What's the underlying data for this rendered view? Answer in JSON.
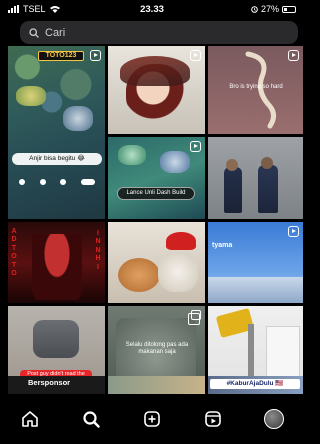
{
  "status_bar": {
    "carrier": "TSEL",
    "time": "23.33",
    "battery": "27%"
  },
  "search": {
    "placeholder": "Cari"
  },
  "tiles": {
    "t1": {
      "logo": "TOTO123",
      "caption": "Anjir bisa begitu 😂"
    },
    "t3": {
      "caption": "Bro is trying so hard"
    },
    "t5": {
      "caption": "Lance Unli Dash Build"
    },
    "t7": {
      "side_text": "A D T O T O",
      "side_text_right": "I N N H I"
    },
    "t9": {
      "watermark": "tyama"
    },
    "t10": {
      "caption": "Post guy didn't read the warning label 😂"
    },
    "t11": {
      "caption": "Selalu ditolong pas ada makanan saja"
    },
    "t13": {
      "caption": "Bersponsor"
    },
    "t15": {
      "caption": "#KaburAjaDulu 🇺🇸"
    }
  },
  "nav": {
    "items": [
      {
        "icon": "home-icon"
      },
      {
        "icon": "search-icon"
      },
      {
        "icon": "create-icon"
      },
      {
        "icon": "reels-icon"
      },
      {
        "icon": "profile-avatar"
      }
    ]
  },
  "colors": {
    "background": "#000000",
    "search_bg": "#2a2a2c"
  }
}
